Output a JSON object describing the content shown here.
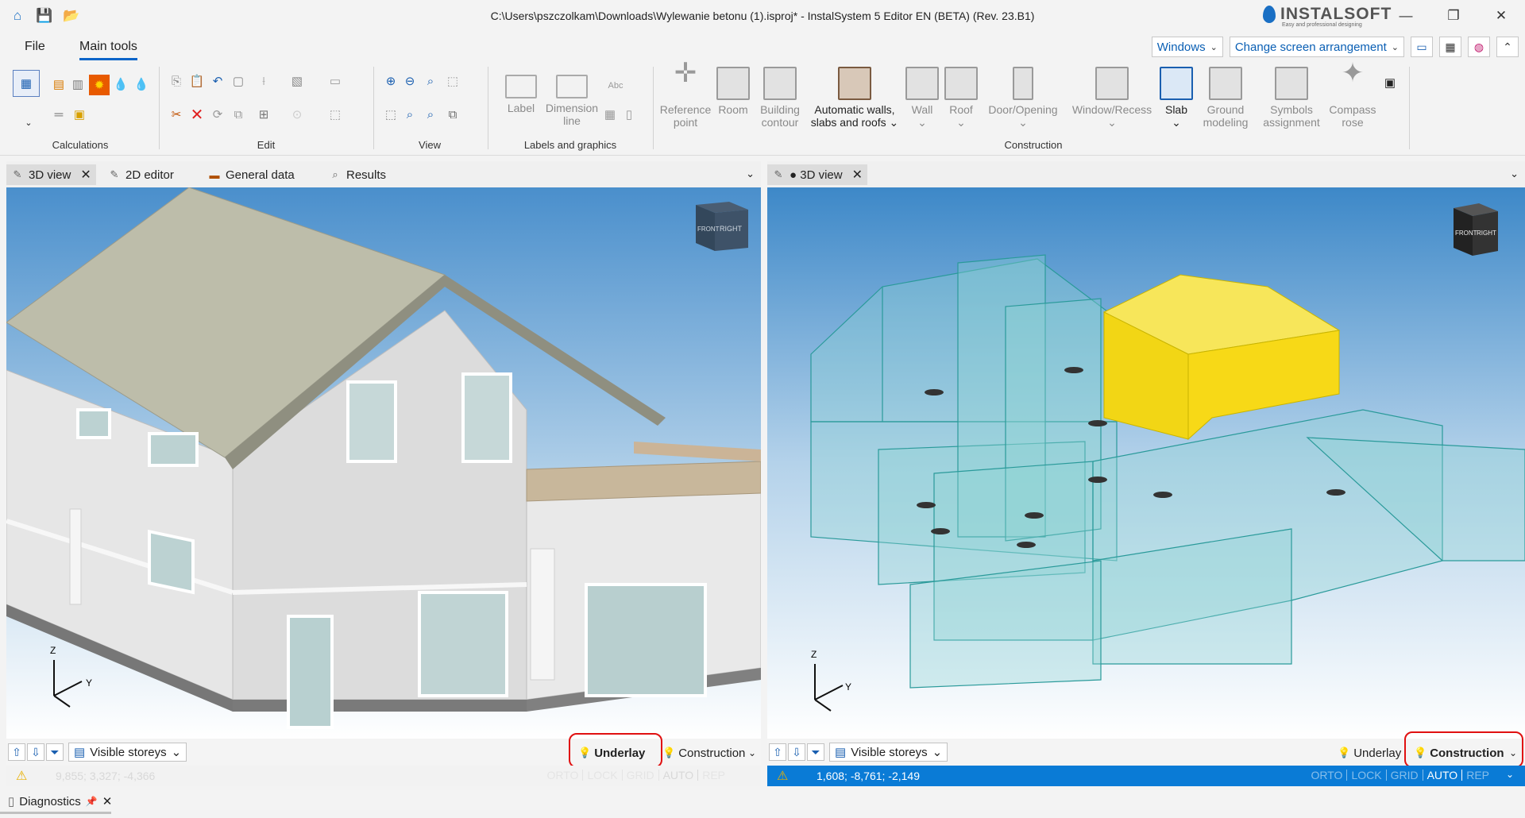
{
  "window": {
    "title": "C:\\Users\\pszczolkam\\Downloads\\Wylewanie betonu (1).isproj* - InstalSystem 5 Editor EN (BETA) (Rev. 23.B1)",
    "brand": "INSTALSOFT",
    "brand_tagline": "Easy and professional designing"
  },
  "menu": {
    "file": "File",
    "main_tools": "Main tools",
    "windows": "Windows",
    "screen_arrangement": "Change screen arrangement"
  },
  "ribbon": {
    "groups": {
      "calculations": "Calculations",
      "edit": "Edit",
      "view": "View",
      "labels": "Labels and graphics",
      "construction": "Construction"
    },
    "buttons": {
      "label": "Label",
      "dimension1": "Dimension",
      "dimension2": "line",
      "reference1": "Reference",
      "reference2": "point",
      "room": "Room",
      "building1": "Building",
      "building2": "contour",
      "auto1": "Automatic walls,",
      "auto2": "slabs and roofs",
      "wall": "Wall",
      "roof": "Roof",
      "door": "Door/Opening",
      "window": "Window/Recess",
      "slab": "Slab",
      "ground1": "Ground",
      "ground2": "modeling",
      "symbols1": "Symbols",
      "symbols2": "assignment",
      "compass1": "Compass",
      "compass2": "rose",
      "abc": "Abc"
    }
  },
  "left_panel": {
    "tabs": [
      "3D view",
      "2D editor",
      "General data",
      "Results"
    ],
    "visible_storeys": "Visible storeys",
    "underlay": "Underlay",
    "construction": "Construction",
    "coords": "9,855; 3,327; -4,366",
    "toggles": [
      "ORTO",
      "LOCK",
      "GRID",
      "AUTO",
      "REP"
    ]
  },
  "right_panel": {
    "tab": "● 3D view",
    "visible_storeys": "Visible storeys",
    "underlay": "Underlay",
    "construction": "Construction",
    "coords": "1,608; -8,761; -2,149",
    "toggles": [
      "ORTO",
      "LOCK",
      "GRID",
      "AUTO",
      "REP"
    ]
  },
  "viewcube": {
    "front": "FRONT",
    "right": "RIGHT"
  },
  "axes": {
    "z": "Z",
    "y": "Y"
  },
  "diagnostics": "Diagnostics",
  "colors": {
    "accent": "#0a64c8",
    "status_blue": "#0a7bd6",
    "highlight_ring": "#e01010",
    "selected_volume": "#f7d917",
    "volume": "#8fd3d3"
  }
}
